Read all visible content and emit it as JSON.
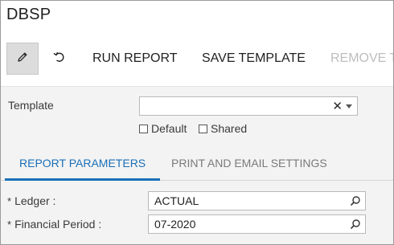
{
  "window": {
    "title": "DBSP"
  },
  "toolbar": {
    "edit_icon": "pencil-icon",
    "undo_icon": "undo-icon",
    "run_report": "RUN REPORT",
    "save_template": "SAVE TEMPLATE",
    "remove_template": "REMOVE T"
  },
  "template": {
    "label": "Template",
    "value": "",
    "clear_glyph": "✕",
    "default_label": "Default",
    "shared_label": "Shared"
  },
  "tabs": [
    {
      "label": "REPORT PARAMETERS",
      "active": true
    },
    {
      "label": "PRINT AND EMAIL SETTINGS",
      "active": false
    }
  ],
  "params": {
    "required_mark": "*",
    "ledger_label": "Ledger :",
    "ledger_value": "ACTUAL",
    "period_label": "Financial Period :",
    "period_value": "07-2020"
  },
  "colors": {
    "accent": "#1a6fb7",
    "disabled_text": "#bdbdbd",
    "form_background": "#f3f3f3"
  }
}
